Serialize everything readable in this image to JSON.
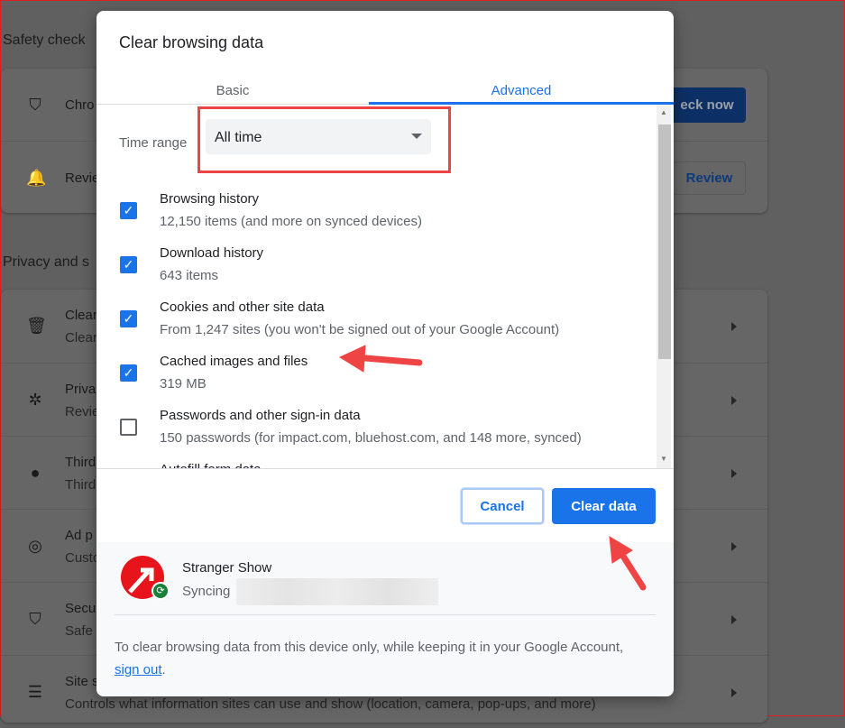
{
  "background": {
    "safety_title": "Safety check",
    "safety_rows": [
      {
        "icon": "shield-check-icon",
        "text": "Chro"
      },
      {
        "icon": "bell-icon",
        "text": "Revie"
      }
    ],
    "check_now": "eck now",
    "review": "Review",
    "privacy_title": "Privacy and s",
    "privacy_rows": [
      {
        "icon": "trash-icon",
        "title": "Clear",
        "sub": "Clear"
      },
      {
        "icon": "compass-icon",
        "title": "Priva",
        "sub": "Revie"
      },
      {
        "icon": "cookie-icon",
        "title": "Third",
        "sub": "Third"
      },
      {
        "icon": "ad-target-icon",
        "title": "Ad p",
        "sub": "Custo"
      },
      {
        "icon": "shield-half-icon",
        "title": "Secu",
        "sub": "Safe"
      },
      {
        "icon": "sliders-icon",
        "title": "Site s",
        "sub": "Controls what information sites can use and show (location, camera, pop-ups, and more)"
      }
    ]
  },
  "dialog": {
    "title": "Clear browsing data",
    "tabs": [
      {
        "label": "Basic",
        "active": false
      },
      {
        "label": "Advanced",
        "active": true
      }
    ],
    "time_range": {
      "label": "Time range",
      "value": "All time"
    },
    "items": [
      {
        "label": "Browsing history",
        "sub": "12,150 items (and more on synced devices)",
        "checked": true
      },
      {
        "label": "Download history",
        "sub": "643 items",
        "checked": true
      },
      {
        "label": "Cookies and other site data",
        "sub": "From 1,247 sites (you won't be signed out of your Google Account)",
        "checked": true
      },
      {
        "label": "Cached images and files",
        "sub": "319 MB",
        "checked": true
      },
      {
        "label": "Passwords and other sign-in data",
        "sub": "150 passwords (for impact.com, bluehost.com, and 148 more, synced)",
        "checked": false
      },
      {
        "label": "Autofill form data",
        "sub": "",
        "checked": true
      }
    ],
    "cancel": "Cancel",
    "clear": "Clear data",
    "account": {
      "name": "Stranger Show",
      "status": "Syncing"
    },
    "note_text": "To clear browsing data from this device only, while keeping it in your Google Account, ",
    "note_link": "sign out",
    "note_end": "."
  },
  "colors": {
    "accent": "#1a73e8",
    "annotation": "#ef4444"
  }
}
